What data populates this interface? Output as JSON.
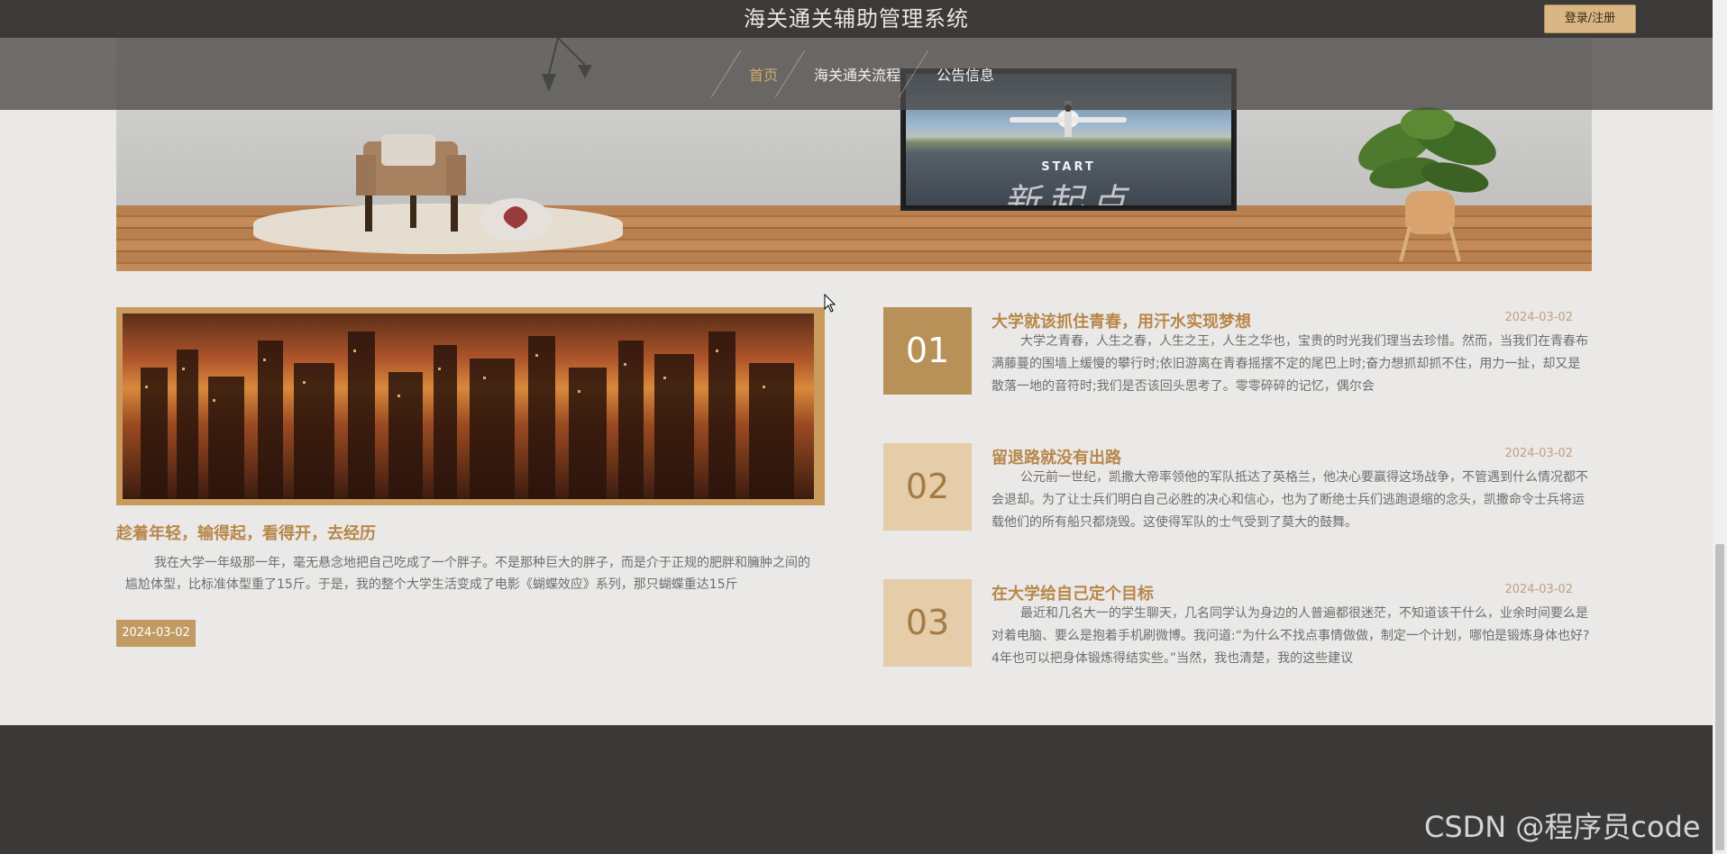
{
  "header": {
    "site_title": "海关通关辅助管理系统",
    "login_label": "登录/注册"
  },
  "nav": {
    "items": [
      {
        "label": "首页",
        "active": true
      },
      {
        "label": "海关通关流程",
        "active": false
      },
      {
        "label": "公告信息",
        "active": false
      }
    ]
  },
  "banner": {
    "tv_line1": "START",
    "tv_line2": "新起点"
  },
  "feature": {
    "title": "趁着年轻，输得起，看得开，去经历",
    "text": "我在大学一年级那一年，毫无悬念地把自己吃成了一个胖子。不是那种巨大的胖子，而是介于正规的肥胖和臃肿之间的尴尬体型，比标准体型重了15斤。于是，我的整个大学生活变成了电影《蝴蝶效应》系列，那只蝴蝶重达15斤",
    "date": "2024-03-02"
  },
  "news": [
    {
      "num": "01",
      "title": "大学就该抓住青春，用汗水实现梦想",
      "date": "2024-03-02",
      "body": "大学之青春，人生之春，人生之王，人生之华也，宝贵的时光我们理当去珍惜。然而，当我们在青春布满藤蔓的围墙上缓慢的攀行时;依旧游离在青春摇摆不定的尾巴上时;奋力想抓却抓不住，用力一扯，却又是散落一地的音符时;我们是否该回头思考了。零零碎碎的记忆，偶尔会",
      "color": "#b89159"
    },
    {
      "num": "02",
      "title": "留退路就没有出路",
      "date": "2024-03-02",
      "body": "公元前一世纪，凯撒大帝率领他的军队抵达了英格兰，他决心要赢得这场战争，不管遇到什么情况都不会退却。为了让士兵们明白自己必胜的决心和信心，也为了断绝士兵们逃跑退缩的念头，凯撒命令士兵将运载他们的所有船只都烧毁。这使得军队的士气受到了莫大的鼓舞。",
      "color": "#e4cda8"
    },
    {
      "num": "03",
      "title": "在大学给自己定个目标",
      "date": "2024-03-02",
      "body": "最近和几名大一的学生聊天，几名同学认为身边的人普遍都很迷茫，不知道该干什么，业余时间要么是对着电脑、要么是抱着手机刷微博。我问道:“为什么不找点事情做做，制定一个计划，哪怕是锻炼身体也好?4年也可以把身体锻炼得结实些。”当然，我也清楚，我的这些建议",
      "color": "#e4cda8"
    }
  ],
  "watermark": "CSDN @程序员code",
  "colors": {
    "accent": "#b7874a",
    "button": "#d9b684",
    "topbar": "#3c3a38",
    "footer": "#3a3938"
  }
}
